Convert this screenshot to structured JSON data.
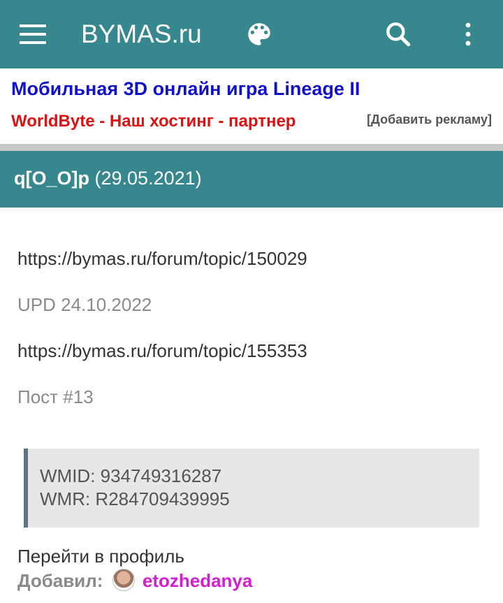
{
  "appbar": {
    "title": "BYMAS.ru",
    "background_color": "#37878f",
    "icons": [
      "menu-icon",
      "palette-icon",
      "search-icon",
      "more-vert-icon"
    ]
  },
  "ads": {
    "link_1": "Мобильная 3D онлайн игра Lineage II",
    "link_1_color": "#1111cc",
    "link_2": "WorldByte - Наш хостинг - партнер",
    "link_2_color": "#e01010",
    "add_ad": "[Добавить рекламу]"
  },
  "post": {
    "author": "q[O_O]p",
    "date": "(29.05.2021)",
    "lines": {
      "link_1": "https://bymas.ru/forum/topic/150029",
      "update": "UPD 24.10.2022",
      "link_2": "https://bymas.ru/forum/topic/155353",
      "post_ref": "Пост #13"
    },
    "quote": {
      "wmid": "WMID: 934749316287",
      "wmr": "WMR: R284709439995"
    },
    "profile_link": "Перейти в профиль",
    "added_by_label": "Добавил:",
    "added_by_user": "etozhedanya",
    "added_by_user_color": "#d21fd2"
  }
}
